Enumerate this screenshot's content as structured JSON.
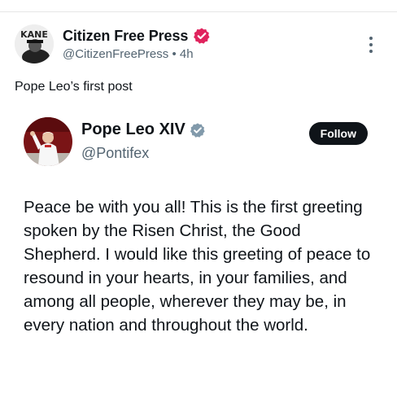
{
  "post": {
    "author_name": "Citizen Free Press",
    "handle": "@CitizenFreePress",
    "separator": "•",
    "time": "4h",
    "avatar_text": "KANE",
    "text": "Pope Leo’s first post"
  },
  "quote": {
    "author_name": "Pope Leo XIV",
    "handle": "@Pontifex",
    "follow_label": "Follow",
    "body": "Peace be with you all! This is the first greeting spoken by the Risen Christ, the Good Shepherd. I would like this greeting of peace to resound in your hearts, in your families, and among all people, wherever they may be, in every nation and throughout the world."
  },
  "colors": {
    "verified_red": "#e0245e",
    "verified_gray": "#829aab",
    "text_primary": "#0f1419",
    "text_secondary": "#536471",
    "button_dark": "#0f1419"
  },
  "icons": {
    "post_verified": "verified-badge-icon",
    "quote_verified": "verified-badge-icon",
    "more": "more-options-icon"
  }
}
